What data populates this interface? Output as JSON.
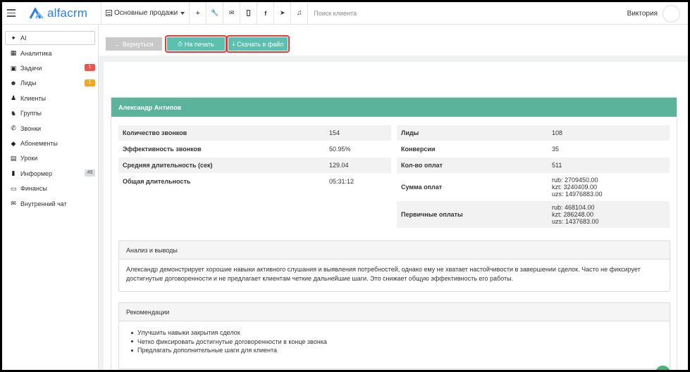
{
  "topbar": {
    "logo_text": "alfacrm",
    "branch": "Основные продажи",
    "search_placeholder": "Поиск клиента",
    "user_name": "Виктория",
    "buttons": [
      "+",
      "🔧",
      "✉",
      "📱",
      "f",
      "✈",
      "🔔"
    ]
  },
  "sidebar": {
    "items": [
      {
        "label": "AI",
        "icon": "sparkle-icon",
        "glyph": "✦"
      },
      {
        "label": "Аналитика",
        "icon": "analytics-icon",
        "glyph": "▦"
      },
      {
        "label": "Задачи",
        "icon": "tasks-icon",
        "glyph": "☑",
        "badge": "1"
      },
      {
        "label": "Лиды",
        "icon": "leads-icon",
        "glyph": "👤",
        "badge": "1"
      },
      {
        "label": "Клиенты",
        "icon": "clients-icon",
        "glyph": "👤"
      },
      {
        "label": "Группы",
        "icon": "groups-icon",
        "glyph": "👥"
      },
      {
        "label": "Звонки",
        "icon": "phone-icon",
        "glyph": "✆"
      },
      {
        "label": "Абонементы",
        "icon": "tag-icon",
        "glyph": "◆"
      },
      {
        "label": "Уроки",
        "icon": "calendar-icon",
        "glyph": "▤"
      },
      {
        "label": "Информер",
        "icon": "informer-icon",
        "glyph": "▮",
        "badge": "49"
      },
      {
        "label": "Финансы",
        "icon": "finance-icon",
        "glyph": "▭"
      },
      {
        "label": "Внутренний чат",
        "icon": "chat-icon",
        "glyph": "✉"
      }
    ]
  },
  "toolbar": {
    "back_label": "← Вернуться",
    "print_label": "На печать",
    "download_label": "Скачать в файл"
  },
  "card": {
    "title": "Александр Антипов",
    "left_stats": [
      {
        "label": "Количество звонков",
        "value": "154"
      },
      {
        "label": "Эффективность звонков",
        "value": "50.95%"
      },
      {
        "label": "Средняя длительность (сек)",
        "value": "129.04"
      },
      {
        "label": "Общая длительность",
        "value": "05:31:12"
      }
    ],
    "right_stats": [
      {
        "label": "Лиды",
        "value": "108"
      },
      {
        "label": "Конверсии",
        "value": "35"
      },
      {
        "label": "Кол-во оплат",
        "value": "511"
      },
      {
        "label": "Сумма оплат",
        "lines": [
          "rub: 2709450.00",
          "kzt: 3240409.00",
          "uzs: 14976883.00"
        ]
      },
      {
        "label": "Первичные оплаты",
        "lines": [
          "rub: 468104.00",
          "kzt: 286248.00",
          "uzs: 1437683.00"
        ]
      }
    ],
    "analysis": {
      "title": "Анализ и выводы",
      "text": "Александр демонстрирует хорошие навыки активного слушания и выявления потребностей, однако ему не хватает настойчивости в завершении сделок. Часто не фиксирует достигнутые договоренности и не предлагает клиентам четкие дальнейшие шаги. Это снижает общую эффективность его работы."
    },
    "recommendations": {
      "title": "Рекомендации",
      "items": [
        "Улучшить навыки закрытия сделок",
        "Четко фиксировать достигнутые договоренности в конце звонка",
        "Предлагать дополнительные шаги для клиента"
      ]
    }
  },
  "colors": {
    "accent": "#5bc0b0",
    "card_header": "#5bb39b",
    "highlight": "#e53935",
    "logo": "#2d7fe0"
  }
}
